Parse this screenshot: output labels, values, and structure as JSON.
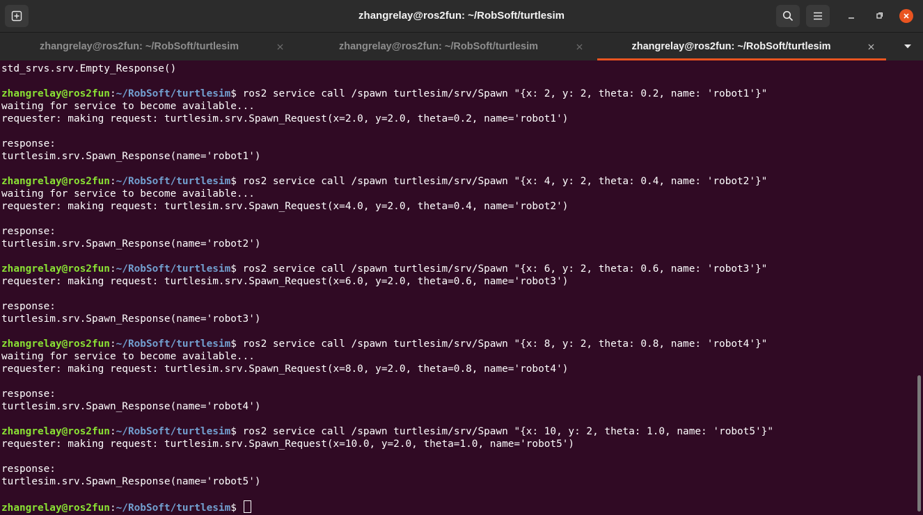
{
  "window": {
    "title": "zhangrelay@ros2fun: ~/RobSoft/turtlesim"
  },
  "tabs": [
    {
      "label": "zhangrelay@ros2fun: ~/RobSoft/turtlesim",
      "active": false
    },
    {
      "label": "zhangrelay@ros2fun: ~/RobSoft/turtlesim",
      "active": false
    },
    {
      "label": "zhangrelay@ros2fun: ~/RobSoft/turtlesim",
      "active": true
    }
  ],
  "icons": {
    "new_tab": "new-tab-icon",
    "search": "search-icon",
    "menu": "hamburger-menu-icon",
    "minimize": "minimize-icon",
    "maximize": "maximize-icon",
    "close": "close-icon",
    "tab_close": "close-icon",
    "tabs_dropdown": "chevron-down-icon"
  },
  "colors": {
    "background": "#300a24",
    "prompt_user": "#8ae234",
    "prompt_path": "#729fcf",
    "accent": "#e95420"
  },
  "prompt": {
    "user": "zhangrelay@ros2fun",
    "sep": ":",
    "path": "~/RobSoft/turtlesim",
    "symbol": "$ "
  },
  "terminal": {
    "lines": [
      "std_srvs.srv.Empty_Response()",
      "",
      "ros2 service call /spawn turtlesim/srv/Spawn \"{x: 2, y: 2, theta: 0.2, name: 'robot1'}\"",
      "waiting for service to become available...",
      "requester: making request: turtlesim.srv.Spawn_Request(x=2.0, y=2.0, theta=0.2, name='robot1')",
      "",
      "response:",
      "turtlesim.srv.Spawn_Response(name='robot1')",
      "",
      "ros2 service call /spawn turtlesim/srv/Spawn \"{x: 4, y: 2, theta: 0.4, name: 'robot2'}\"",
      "waiting for service to become available...",
      "requester: making request: turtlesim.srv.Spawn_Request(x=4.0, y=2.0, theta=0.4, name='robot2')",
      "",
      "response:",
      "turtlesim.srv.Spawn_Response(name='robot2')",
      "",
      "ros2 service call /spawn turtlesim/srv/Spawn \"{x: 6, y: 2, theta: 0.6, name: 'robot3'}\"",
      "requester: making request: turtlesim.srv.Spawn_Request(x=6.0, y=2.0, theta=0.6, name='robot3')",
      "",
      "response:",
      "turtlesim.srv.Spawn_Response(name='robot3')",
      "",
      "ros2 service call /spawn turtlesim/srv/Spawn \"{x: 8, y: 2, theta: 0.8, name: 'robot4'}\"",
      "waiting for service to become available...",
      "requester: making request: turtlesim.srv.Spawn_Request(x=8.0, y=2.0, theta=0.8, name='robot4')",
      "",
      "response:",
      "turtlesim.srv.Spawn_Response(name='robot4')",
      "",
      "ros2 service call /spawn turtlesim/srv/Spawn \"{x: 10, y: 2, theta: 1.0, name: 'robot5'}\"",
      "requester: making request: turtlesim.srv.Spawn_Request(x=10.0, y=2.0, theta=1.0, name='robot5')",
      "",
      "response:",
      "turtlesim.srv.Spawn_Response(name='robot5')",
      "",
      ""
    ]
  }
}
